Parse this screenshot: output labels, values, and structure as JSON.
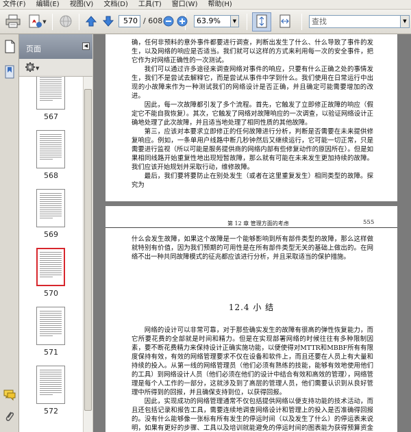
{
  "menu": [
    "文件(F)",
    "编辑(E)",
    "视图(V)",
    "文档(D)",
    "工具(T)",
    "窗口(W)",
    "帮助(H)"
  ],
  "toolbar": {
    "current_page": "570",
    "total_pages": "/ 608",
    "zoom": "63.9%",
    "search_placeholder": "查找"
  },
  "panel": {
    "title": "页面",
    "thumbnails": [
      {
        "label": "567",
        "selected": false
      },
      {
        "label": "568",
        "selected": false
      },
      {
        "label": "569",
        "selected": false
      },
      {
        "label": "570",
        "selected": true
      },
      {
        "label": "571",
        "selected": false
      },
      {
        "label": "572",
        "selected": false
      }
    ]
  },
  "page_top": {
    "paragraphs": [
      "确，任何非预料的意外事件都要进行调查，判断出发生了什么、什么导致了事件的发生，以及网络的响应是否适当。我们就可以这样的方式来利用每一次的安全事件，把它作为对网络正确性的一次测试。",
      "我们可以通过许多途径来调查网络对事件的响应，只要有什么正确之处的事情发生，我们不是尝试去解释它，而是尝试从事件中学到什么。我们使用在日常运行中出现的小故障来作为一种测试我们的网络设计是否正确，并且确定可能需要增加的改进。",
      "因此，每一次故障都引发了多个流程。首先，它触发了立即修正故障的响应（假定它不能自我恢复）。其次，它触发了网络对故障响应的一次调查，以验证网络设计正确地处理了此次故障，并且适当地处理了相同性质的其他故障。",
      "第三，应该对本要求立即修正的任何故障进行分析，判断是否需要在未来提供修复响应。例如，一条单用户线路中断几秒钟然后又继续运行，它可能一切正常，只是需要进行监视（所以可能是服务提供商的网络内部有些修复动作的原因所在）。但是如果相同线路开始重复性地出现短暂故障，那么就有可能在未来发生更加持续的故障。我们应该开始规划并采取行动，维修故障。",
      "最后，我们要将要防止在别处发生（或者在这里重复发生）相同类型的故障。探究为"
    ]
  },
  "page_bottom": {
    "header_left": "第 12 章   管理方面的考虑",
    "header_right": "555",
    "intro": "什么会发生故障，如果这个故障是一个能够影响到所有部件类型的故障，那么这样做就特别有价值，因为我们预期的可用性是在所有部件类型无关的基础上做出的。在网络不出一种共同故障模式的征兆都应该进行分析，并且采取适当的保护措施。",
    "section_title": "12.4   小   结",
    "paragraphs": [
      "网络的设计可以非常可靠，对于那些确实发生的故障有很高的弹性恢复能力，而它所要花费的全部就是时间和精力。但是在实现部署网络的时候往往有多种限制因素，要不断花费精力来保持设计正确实施功能，以便使得对MTTR和MBBF所有有限度保持有效，有效的网络管理要求不仅在设备和软件上，而且还要在人员上有大量和持续的投入。从第一线的网络管理员（他们必须有熟练的技能，能够有效地使用他们的工具）到网络设计人员（他们必须在他们的设计中结合有效和高效的管理），网络管理是每个人工作的一部分，这就涉及到了高层的管理人员，他们需要认识到从良好管理中所得到的回报，并且确保支持到位，以获得回报。",
      "因此，实现成功的网络管理通常不仅包括提供网络以便支持功能的技术活动，而且还包括记录和报告工具，需要连续地调查网络设计和管理上的投入是否准确得回报的。没有什么能够像一张标有所有发生的停运时间（以及发生了什么）的停运表来说明，如果有更好的步骤、工具以及培训就能避免的停运时间的图表能为获得预算资金和高层管理支持提供有利证据的了。"
    ]
  }
}
